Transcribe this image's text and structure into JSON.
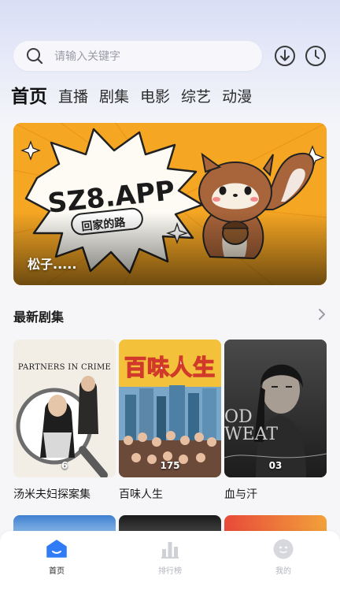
{
  "search": {
    "placeholder": "请输入关键字"
  },
  "top_icons": [
    "download-icon",
    "history-clock-icon"
  ],
  "tabs": [
    {
      "label": "首页",
      "active": true
    },
    {
      "label": "直播"
    },
    {
      "label": "剧集"
    },
    {
      "label": "电影"
    },
    {
      "label": "综艺"
    },
    {
      "label": "动漫"
    }
  ],
  "banner": {
    "headline": "SZ8.APP",
    "subline": "回家的路",
    "caption": "松子....."
  },
  "section": {
    "title": "最新剧集",
    "more_icon": "chevron-right-icon"
  },
  "cards": [
    {
      "title": "汤米夫妇探案集",
      "count": "6",
      "poster_text": "PARTNERS IN CRIME"
    },
    {
      "title": "百味人生",
      "count": "175",
      "poster_text": "百味人生"
    },
    {
      "title": "血与汗",
      "count": "03",
      "poster_text": "OD WEAT"
    }
  ],
  "bottom_nav": [
    {
      "label": "首页",
      "icon": "home-icon",
      "active": true
    },
    {
      "label": "排行榜",
      "icon": "ranking-icon"
    },
    {
      "label": "我的",
      "icon": "profile-icon"
    }
  ],
  "colors": {
    "accent": "#2f7cf6",
    "banner_bg": "#f4a527"
  }
}
